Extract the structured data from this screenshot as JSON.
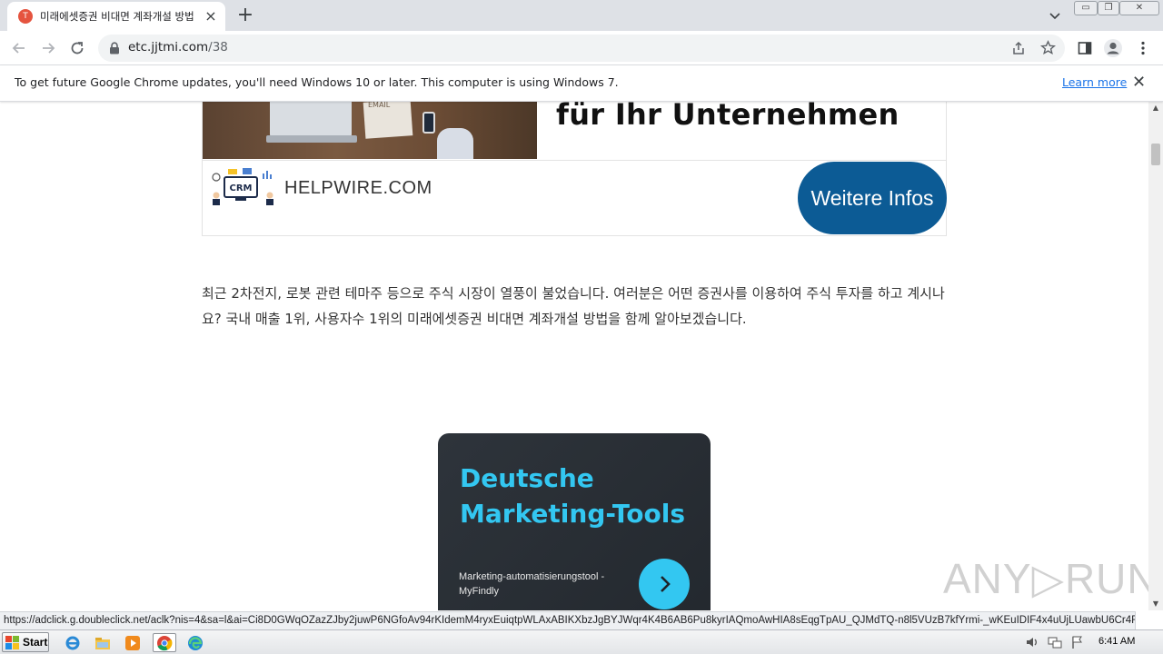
{
  "browser": {
    "tab": {
      "title": "미래에셋증권 비대면 계좌개설 방법",
      "favicon": "T"
    },
    "url": {
      "host": "etc.jjtmi.com",
      "path": "/38"
    }
  },
  "infobar": {
    "message": "To get future Google Chrome updates, you'll need Windows 10 or later. This computer is using Windows 7.",
    "link_label": "Learn more"
  },
  "ad_top": {
    "photo_text": "EMAIL",
    "headline": "für Ihr Unternehmen",
    "logo_text": "CRM",
    "brand": "HELPWIRE.COM",
    "cta": "Weitere Infos",
    "cta_color": "#0c5b95"
  },
  "article": {
    "paragraph": "최근 2차전지, 로봇 관련 테마주 등으로 주식 시장이 열풍이 불었습니다. 여러분은 어떤 증권사를 이용하여 주식 투자를 하고 계시나요? 국내 매출 1위, 사용자수 1위의 미래에셋증권 비대면 계좌개설 방법을 함께 알아보겠습니다."
  },
  "ad_bottom": {
    "title": "Deutsche Marketing-Tools",
    "subtitle": "Marketing-automatisierungstool - MyFindly",
    "accent_color": "#33c7f1"
  },
  "watermark": "ANY▷RUN",
  "status_url": "https://adclick.g.doubleclick.net/aclk?nis=4&sa=l&ai=Ci8D0GWqOZazZJby2juwP6NGfoAv94rKIdemM4ryxEuiqtpWLAxABIKXbzJgBYJWqr4K4B6AB6Pu8kyrIAQmoAwHIA8sEqgTpAU_QJMdTQ-n8l5VUzB7kfYrmi-_wKEuIDIF4x4uUjLUawbU6Cr4RikTRU2f3d4QmmV...",
  "taskbar": {
    "start_label": "Start",
    "clock": "6:41 AM"
  }
}
